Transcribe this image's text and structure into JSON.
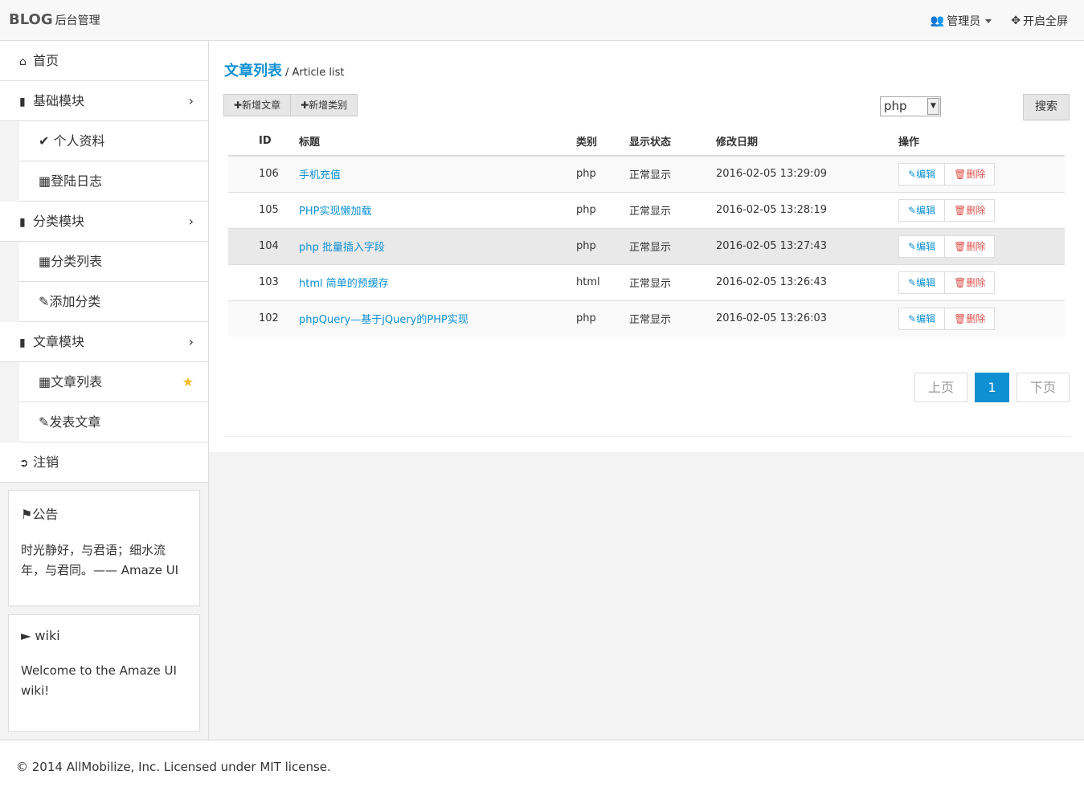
{
  "header": {
    "brand": "BLOG",
    "brand_sub": "后台管理",
    "user_label": "管理员",
    "fullscreen_label": "开启全屏"
  },
  "sidebar": {
    "home": "首页",
    "basic_module": "基础模块",
    "profile": "个人资料",
    "login_log": "登陆日志",
    "category_module": "分类模块",
    "category_list": "分类列表",
    "add_category": "添加分类",
    "article_module": "文章模块",
    "article_list": "文章列表",
    "publish_article": "发表文章",
    "logout": "注销",
    "notice_title": "公告",
    "notice_body": "时光静好，与君语；细水流年，与君同。—— Amaze UI",
    "wiki_title": "wiki",
    "wiki_body": "Welcome to the Amaze UI wiki!"
  },
  "main": {
    "title": "文章列表",
    "subtitle": "/ Article list",
    "add_article": "新增文章",
    "add_category": "新增类别",
    "select_value": "php",
    "search_label": "搜索",
    "columns": [
      "ID",
      "标题",
      "类别",
      "显示状态",
      "修改日期",
      "操作"
    ],
    "rows": [
      {
        "id": "106",
        "title": "手机充值",
        "category": "php",
        "status": "正常显示",
        "date": "2016-02-05 13:29:09"
      },
      {
        "id": "105",
        "title": "PHP实现懒加载",
        "category": "php",
        "status": "正常显示",
        "date": "2016-02-05 13:28:19"
      },
      {
        "id": "104",
        "title": "php 批量插入字段",
        "category": "php",
        "status": "正常显示",
        "date": "2016-02-05 13:27:43"
      },
      {
        "id": "103",
        "title": "html 简单的预缓存",
        "category": "html",
        "status": "正常显示",
        "date": "2016-02-05 13:26:43"
      },
      {
        "id": "102",
        "title": "phpQuery—基于jQuery的PHP实现",
        "category": "php",
        "status": "正常显示",
        "date": "2016-02-05 13:26:03"
      }
    ],
    "edit_label": "编辑",
    "delete_label": "删除",
    "prev_label": "上页",
    "page_current": "1",
    "next_label": "下页"
  },
  "footer": {
    "text": "© 2014 AllMobilize, Inc. Licensed under MIT license."
  }
}
